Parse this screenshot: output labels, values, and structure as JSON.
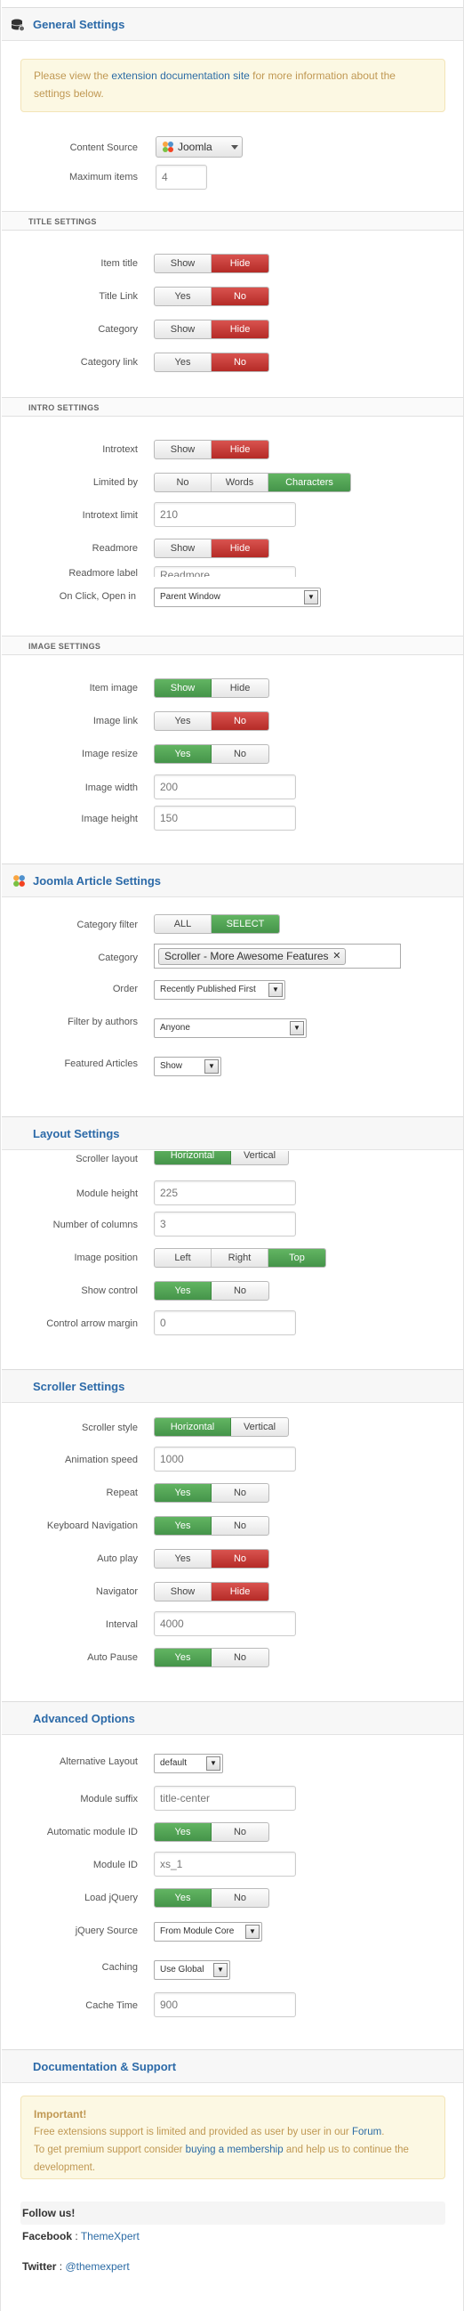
{
  "general": {
    "title": "General Settings",
    "notice_pre": "Please view the ",
    "notice_link": "extension documentation site",
    "notice_post": " for more information about the settings below.",
    "content_source_label": "Content Source",
    "content_source_value": "Joomla",
    "max_items_label": "Maximum items",
    "max_items_value": "4"
  },
  "title_settings": {
    "heading": "TITLE SETTINGS",
    "item_title": {
      "label": "Item title",
      "options": [
        "Show",
        "Hide"
      ]
    },
    "title_link": {
      "label": "Title Link",
      "options": [
        "Yes",
        "No"
      ]
    },
    "category": {
      "label": "Category",
      "options": [
        "Show",
        "Hide"
      ]
    },
    "category_link": {
      "label": "Category link",
      "options": [
        "Yes",
        "No"
      ]
    }
  },
  "intro_settings": {
    "heading": "INTRO SETTINGS",
    "introtext": {
      "label": "Introtext",
      "options": [
        "Show",
        "Hide"
      ]
    },
    "limited_by": {
      "label": "Limited by",
      "options": [
        "No",
        "Words",
        "Characters"
      ]
    },
    "introtext_limit_label": "Introtext limit",
    "introtext_limit_value": "210",
    "readmore": {
      "label": "Readmore",
      "options": [
        "Show",
        "Hide"
      ]
    },
    "readmore_label_label": "Readmore label",
    "readmore_label_value": "Readmore",
    "on_click_label": "On Click, Open in",
    "on_click_value": "Parent Window"
  },
  "image_settings": {
    "heading": "IMAGE SETTINGS",
    "item_image": {
      "label": "Item image",
      "options": [
        "Show",
        "Hide"
      ]
    },
    "image_link": {
      "label": "Image link",
      "options": [
        "Yes",
        "No"
      ]
    },
    "image_resize": {
      "label": "Image resize",
      "options": [
        "Yes",
        "No"
      ]
    },
    "image_width_label": "Image width",
    "image_width_value": "200",
    "image_height_label": "Image height",
    "image_height_value": "150"
  },
  "article": {
    "title": "Joomla Article Settings",
    "category_filter": {
      "label": "Category filter",
      "options": [
        "ALL",
        "SELECT"
      ]
    },
    "category_label": "Category",
    "category_tag": "Scroller - More Awesome Features",
    "category_tag_remove": "✕",
    "order_label": "Order",
    "order_value": "Recently Published First",
    "filter_authors_label": "Filter by authors",
    "filter_authors_value": "Anyone",
    "featured_label": "Featured Articles",
    "featured_value": "Show"
  },
  "layout": {
    "title": "Layout Settings",
    "scroller_layout": {
      "label": "Scroller layout",
      "options": [
        "Horizontal",
        "Vertical"
      ]
    },
    "module_height_label": "Module height",
    "module_height_value": "225",
    "columns_label": "Number of columns",
    "columns_value": "3",
    "image_position": {
      "label": "Image position",
      "options": [
        "Left",
        "Right",
        "Top"
      ]
    },
    "show_control": {
      "label": "Show control",
      "options": [
        "Yes",
        "No"
      ]
    },
    "arrow_margin_label": "Control arrow margin",
    "arrow_margin_value": "0"
  },
  "scroller": {
    "title": "Scroller Settings",
    "style": {
      "label": "Scroller style",
      "options": [
        "Horizontal",
        "Vertical"
      ]
    },
    "speed_label": "Animation speed",
    "speed_value": "1000",
    "repeat": {
      "label": "Repeat",
      "options": [
        "Yes",
        "No"
      ]
    },
    "keyboard": {
      "label": "Keyboard Navigation",
      "options": [
        "Yes",
        "No"
      ]
    },
    "autoplay": {
      "label": "Auto play",
      "options": [
        "Yes",
        "No"
      ]
    },
    "navigator": {
      "label": "Navigator",
      "options": [
        "Show",
        "Hide"
      ]
    },
    "interval_label": "Interval",
    "interval_value": "4000",
    "autopause": {
      "label": "Auto Pause",
      "options": [
        "Yes",
        "No"
      ]
    }
  },
  "advanced": {
    "title": "Advanced Options",
    "alt_layout_label": "Alternative Layout",
    "alt_layout_value": "default",
    "suffix_label": "Module suffix",
    "suffix_placeholder": "title-center",
    "auto_id": {
      "label": "Automatic module ID",
      "options": [
        "Yes",
        "No"
      ]
    },
    "module_id_label": "Module ID",
    "module_id_value": "xs_1",
    "load_jquery": {
      "label": "Load jQuery",
      "options": [
        "Yes",
        "No"
      ]
    },
    "jquery_source_label": "jQuery Source",
    "jquery_source_value": "From Module Core",
    "caching_label": "Caching",
    "caching_value": "Use Global",
    "cache_time_label": "Cache Time",
    "cache_time_value": "900"
  },
  "docs": {
    "title": "Documentation & Support",
    "important": "Important!",
    "line1_pre": "Free extensions support is limited and provided as user by user in our ",
    "line1_link": "Forum",
    "line1_post": ".",
    "line2_pre": "To get premium support consider ",
    "line2_link": "buying a membership",
    "line2_post": " and help us to continue the development.",
    "follow": "Follow us!",
    "facebook_label": "Facebook",
    "facebook_sep": " : ",
    "facebook_link": "ThemeXpert",
    "twitter_label": "Twitter",
    "twitter_sep": " : ",
    "twitter_link": "@themexpert"
  },
  "colors": {
    "accent": "#2c6aa8",
    "active_red": "#c9302c",
    "active_green": "#4cae4c"
  }
}
